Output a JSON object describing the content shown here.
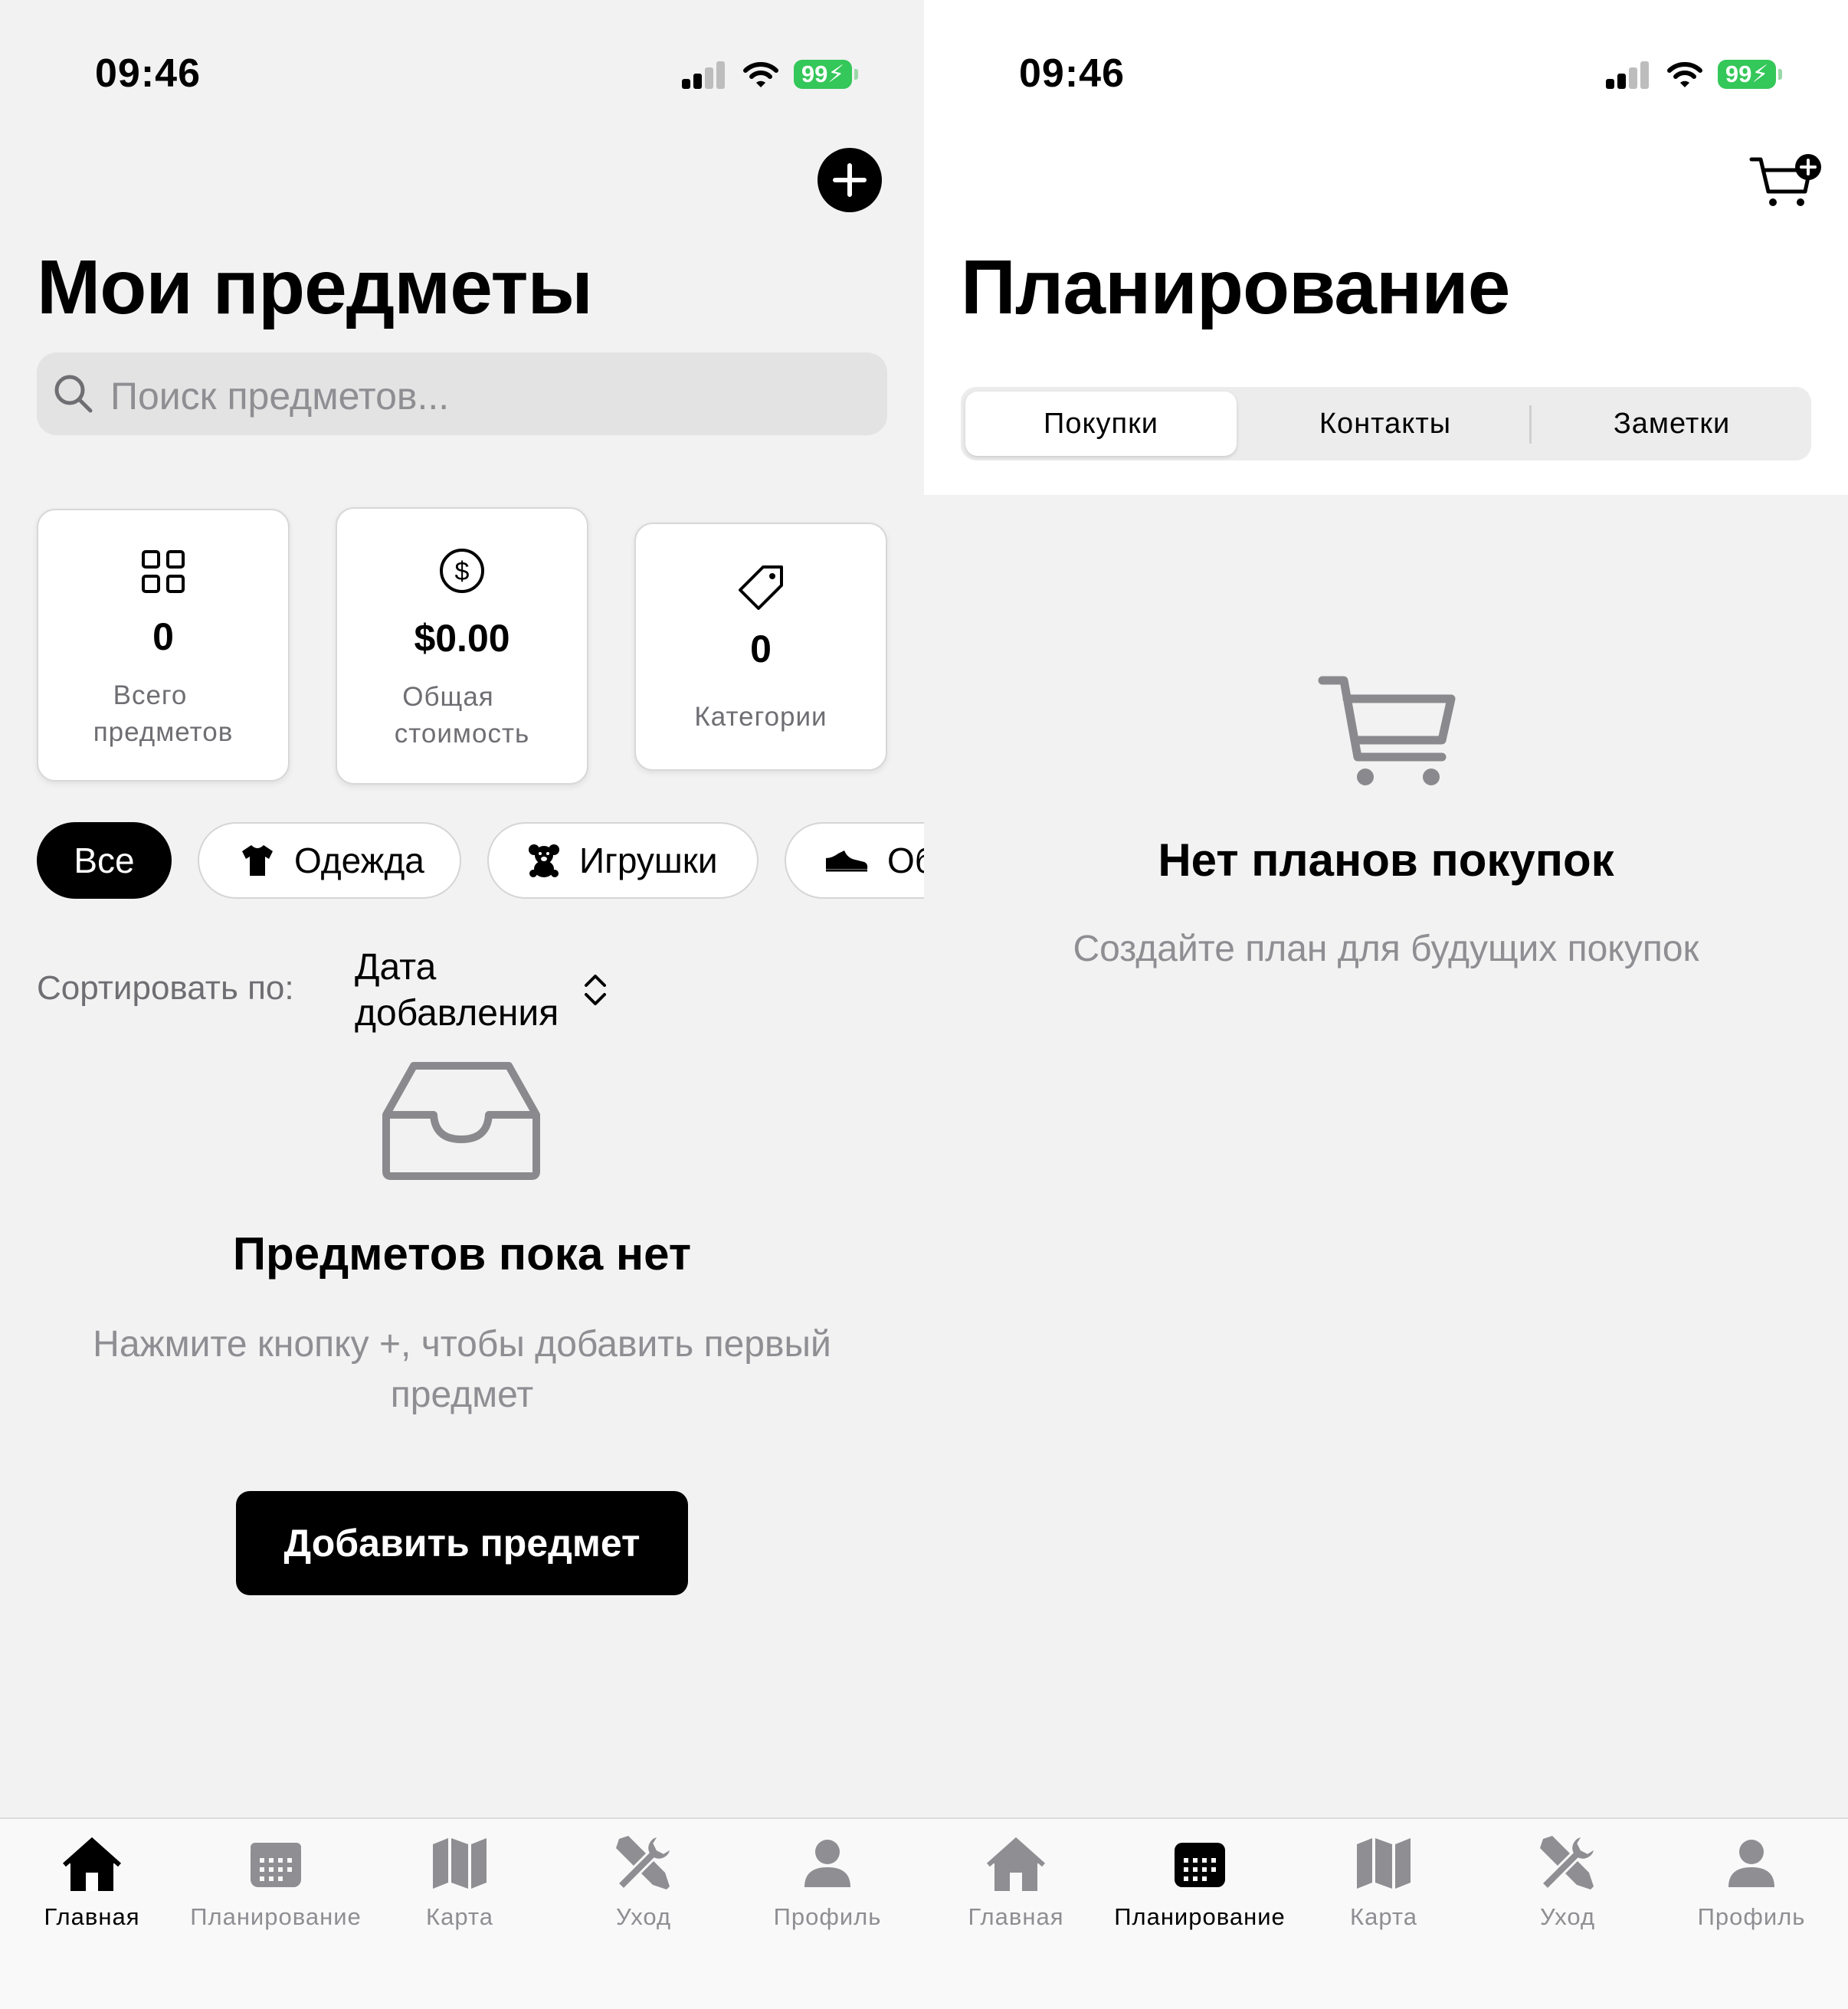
{
  "status_bar": {
    "time": "09:46",
    "battery": "99"
  },
  "left": {
    "title": "Мои предметы",
    "search_placeholder": "Поиск предметов...",
    "stats": [
      {
        "value": "0",
        "label_line1": "Всего",
        "label_line2": "предметов",
        "icon": "grid-icon"
      },
      {
        "value": "$0.00",
        "label_line1": "Общая",
        "label_line2": "стоимость",
        "icon": "dollar-circle-icon"
      },
      {
        "value": "0",
        "label_line1": "Категории",
        "icon": "tag-icon"
      }
    ],
    "chips": [
      "Все",
      "Одежда",
      "Игрушки",
      "Об"
    ],
    "sort": {
      "label": "Сортировать по:",
      "value_line1": "Дата",
      "value_line2": "добавления"
    },
    "empty": {
      "title": "Предметов пока нет",
      "subtitle_line1": "Нажмите кнопку +, чтобы добавить первый",
      "subtitle_line2": "предмет",
      "button": "Добавить предмет"
    }
  },
  "right": {
    "title": "Планирование",
    "segments": [
      "Покупки",
      "Контакты",
      "Заметки"
    ],
    "selected_segment": "Покупки",
    "empty": {
      "title": "Нет планов покупок",
      "subtitle": "Создайте план для будущих покупок"
    }
  },
  "tabbar": {
    "items": [
      "Главная",
      "Планирование",
      "Карта",
      "Уход",
      "Профиль"
    ],
    "active_left": "Главная",
    "active_right": "Планирование"
  },
  "colors": {
    "accent": "#000000",
    "battery": "#34c759",
    "muted": "#8e8e93"
  }
}
